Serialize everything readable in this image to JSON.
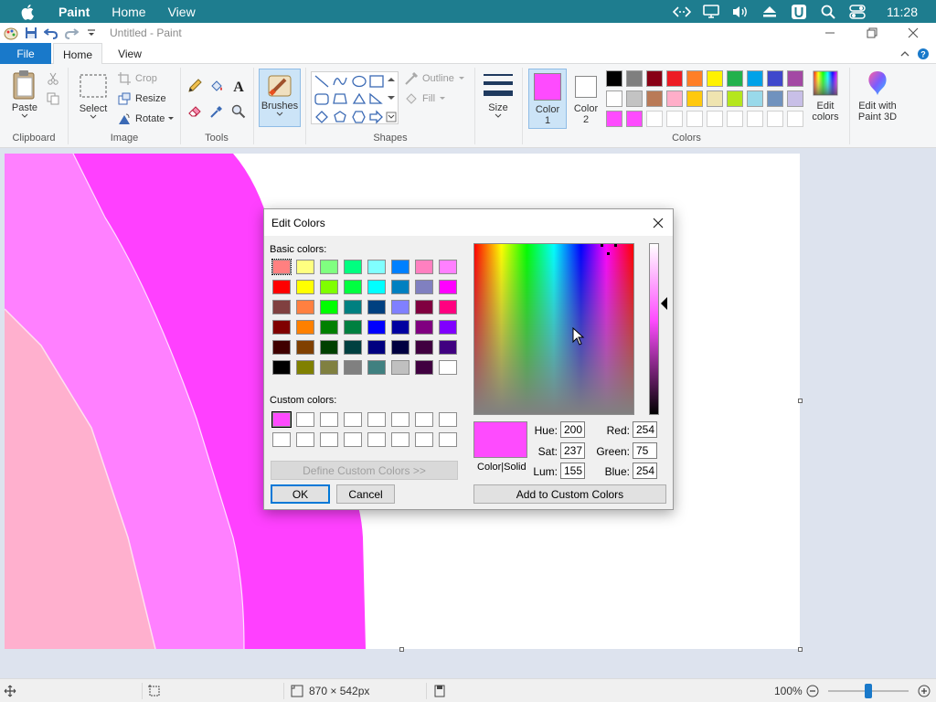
{
  "menubar": {
    "app": "Paint",
    "items": [
      "Home",
      "View"
    ],
    "clock": "11:28"
  },
  "window": {
    "title": "Untitled - Paint"
  },
  "tabs": {
    "file": "File",
    "home": "Home",
    "view": "View"
  },
  "ribbon": {
    "clipboard": {
      "paste": "Paste",
      "label": "Clipboard"
    },
    "image": {
      "select": "Select",
      "crop": "Crop",
      "resize": "Resize",
      "rotate": "Rotate",
      "label": "Image"
    },
    "tools": {
      "label": "Tools"
    },
    "brushes": "Brushes",
    "shapes": {
      "outline": "Outline",
      "fill": "Fill",
      "label": "Shapes"
    },
    "size": "Size",
    "color1": {
      "line1": "Color",
      "line2": "1"
    },
    "color2": {
      "line1": "Color",
      "line2": "2"
    },
    "colors_label": "Colors",
    "edit_colors": {
      "line1": "Edit",
      "line2": "colors"
    },
    "paint3d": {
      "line1": "Edit with",
      "line2": "Paint 3D"
    },
    "accent": "#1979ca",
    "color1_value": "#fe4bfe",
    "color2_value": "#ffffff",
    "palette_row1": [
      "#000000",
      "#7f7f7f",
      "#880015",
      "#ed1c24",
      "#ff7f27",
      "#fff200",
      "#22b14c",
      "#00a2e8",
      "#3f48cc",
      "#a349a4"
    ],
    "palette_row2": [
      "#ffffff",
      "#c3c3c3",
      "#b97a57",
      "#ffaec9",
      "#ffc90e",
      "#efe4b0",
      "#b5e61d",
      "#99d9ea",
      "#7092be",
      "#c8bfe7"
    ],
    "palette_row3": [
      "#fe4bfe",
      "#fe4bfe"
    ]
  },
  "status": {
    "dimensions": "870 × 542px",
    "zoom": "100%"
  },
  "dialog": {
    "title": "Edit Colors",
    "basic_label": "Basic colors:",
    "custom_label": "Custom colors:",
    "define_custom": "Define Custom Colors >>",
    "ok": "OK",
    "cancel": "Cancel",
    "add_custom": "Add to Custom Colors",
    "color_solid": "Color|Solid",
    "hue_label": "Hue:",
    "sat_label": "Sat:",
    "lum_label": "Lum:",
    "red_label": "Red:",
    "green_label": "Green:",
    "blue_label": "Blue:",
    "hue": "200",
    "sat": "237",
    "lum": "155",
    "red": "254",
    "green": "75",
    "blue": "254",
    "preview_color": "#fe4bfe",
    "basic_colors": [
      [
        "#ff8080",
        "#ffff80",
        "#80ff80",
        "#00ff80",
        "#80ffff",
        "#0080ff",
        "#ff80c0",
        "#ff80ff"
      ],
      [
        "#ff0000",
        "#ffff00",
        "#80ff00",
        "#00ff40",
        "#00ffff",
        "#0080c0",
        "#8080c0",
        "#ff00ff"
      ],
      [
        "#804040",
        "#ff8040",
        "#00ff00",
        "#008080",
        "#004080",
        "#8080ff",
        "#800040",
        "#ff0080"
      ],
      [
        "#800000",
        "#ff8000",
        "#008000",
        "#008040",
        "#0000ff",
        "#0000a0",
        "#800080",
        "#8000ff"
      ],
      [
        "#400000",
        "#804000",
        "#004000",
        "#004040",
        "#000080",
        "#000040",
        "#400040",
        "#400080"
      ],
      [
        "#000000",
        "#808000",
        "#808040",
        "#808080",
        "#408080",
        "#c0c0c0",
        "#400040",
        "#ffffff"
      ]
    ],
    "custom_colors": [
      [
        "#fe4bfe",
        "#ffffff",
        "#ffffff",
        "#ffffff",
        "#ffffff",
        "#ffffff",
        "#ffffff",
        "#ffffff"
      ],
      [
        "#ffffff",
        "#ffffff",
        "#ffffff",
        "#ffffff",
        "#ffffff",
        "#ffffff",
        "#ffffff",
        "#ffffff"
      ]
    ]
  }
}
